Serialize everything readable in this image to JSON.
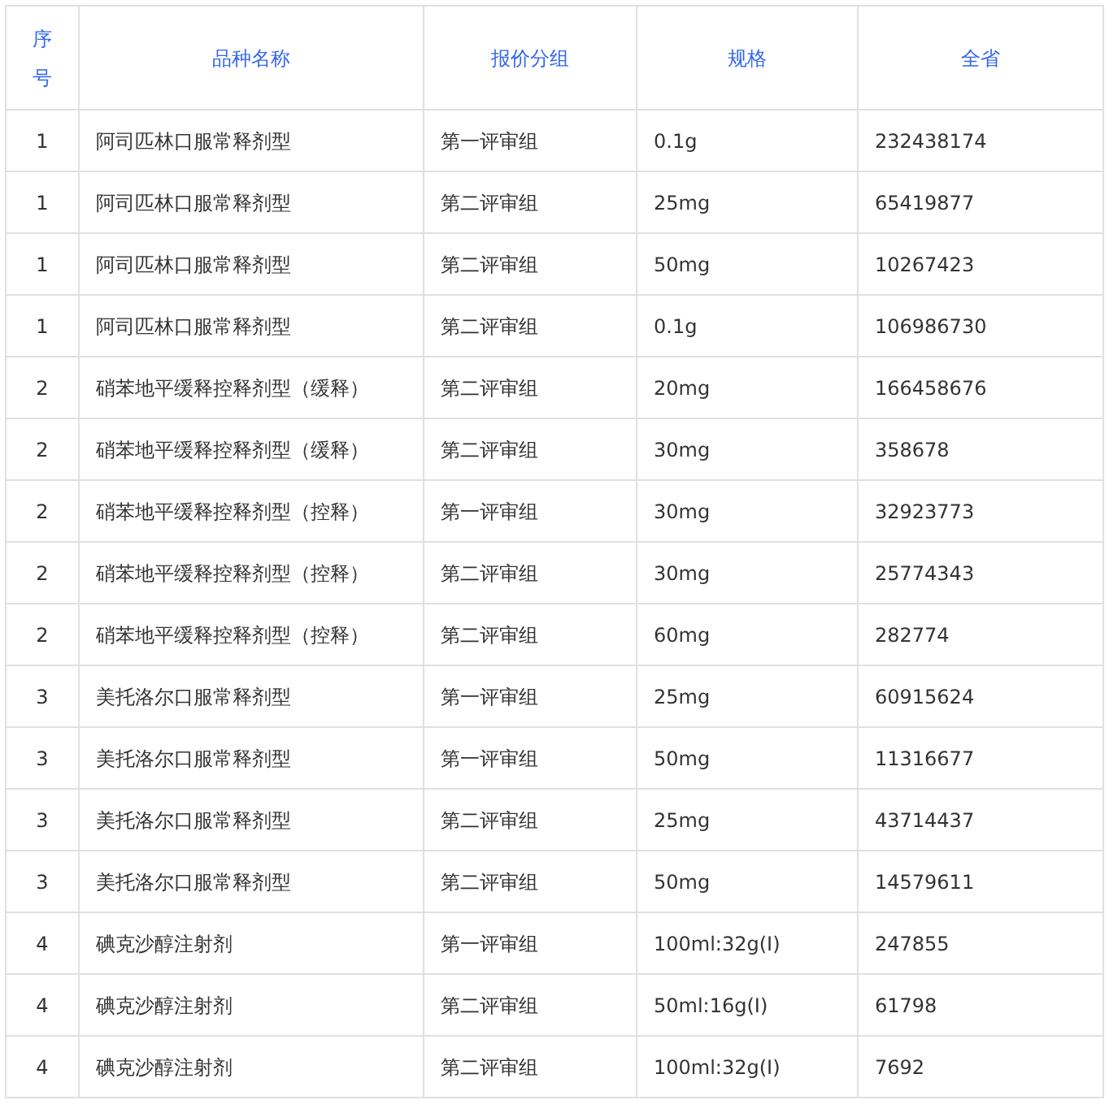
{
  "table": {
    "columns": [
      "序号",
      "品种名称",
      "报价分组",
      "规格",
      "全省"
    ],
    "rows": [
      [
        "1",
        "阿司匹林口服常释剂型",
        "第一评审组",
        "0.1g",
        "232438174"
      ],
      [
        "1",
        "阿司匹林口服常释剂型",
        "第二评审组",
        "25mg",
        "65419877"
      ],
      [
        "1",
        "阿司匹林口服常释剂型",
        "第二评审组",
        "50mg",
        "10267423"
      ],
      [
        "1",
        "阿司匹林口服常释剂型",
        "第二评审组",
        "0.1g",
        "106986730"
      ],
      [
        "2",
        "硝苯地平缓释控释剂型（缓释）",
        "第二评审组",
        "20mg",
        "166458676"
      ],
      [
        "2",
        "硝苯地平缓释控释剂型（缓释）",
        "第二评审组",
        "30mg",
        "358678"
      ],
      [
        "2",
        "硝苯地平缓释控释剂型（控释）",
        "第一评审组",
        "30mg",
        "32923773"
      ],
      [
        "2",
        "硝苯地平缓释控释剂型（控释）",
        "第二评审组",
        "30mg",
        "25774343"
      ],
      [
        "2",
        "硝苯地平缓释控释剂型（控释）",
        "第二评审组",
        "60mg",
        "282774"
      ],
      [
        "3",
        "美托洛尔口服常释剂型",
        "第一评审组",
        "25mg",
        "60915624"
      ],
      [
        "3",
        "美托洛尔口服常释剂型",
        "第一评审组",
        "50mg",
        "11316677"
      ],
      [
        "3",
        "美托洛尔口服常释剂型",
        "第二评审组",
        "25mg",
        "43714437"
      ],
      [
        "3",
        "美托洛尔口服常释剂型",
        "第二评审组",
        "50mg",
        "14579611"
      ],
      [
        "4",
        "碘克沙醇注射剂",
        "第一评审组",
        "100ml:32g(I)",
        "247855"
      ],
      [
        "4",
        "碘克沙醇注射剂",
        "第二评审组",
        "50ml:16g(I)",
        "61798"
      ],
      [
        "4",
        "碘克沙醇注射剂",
        "第二评审组",
        "100ml:32g(I)",
        "7692"
      ]
    ]
  }
}
